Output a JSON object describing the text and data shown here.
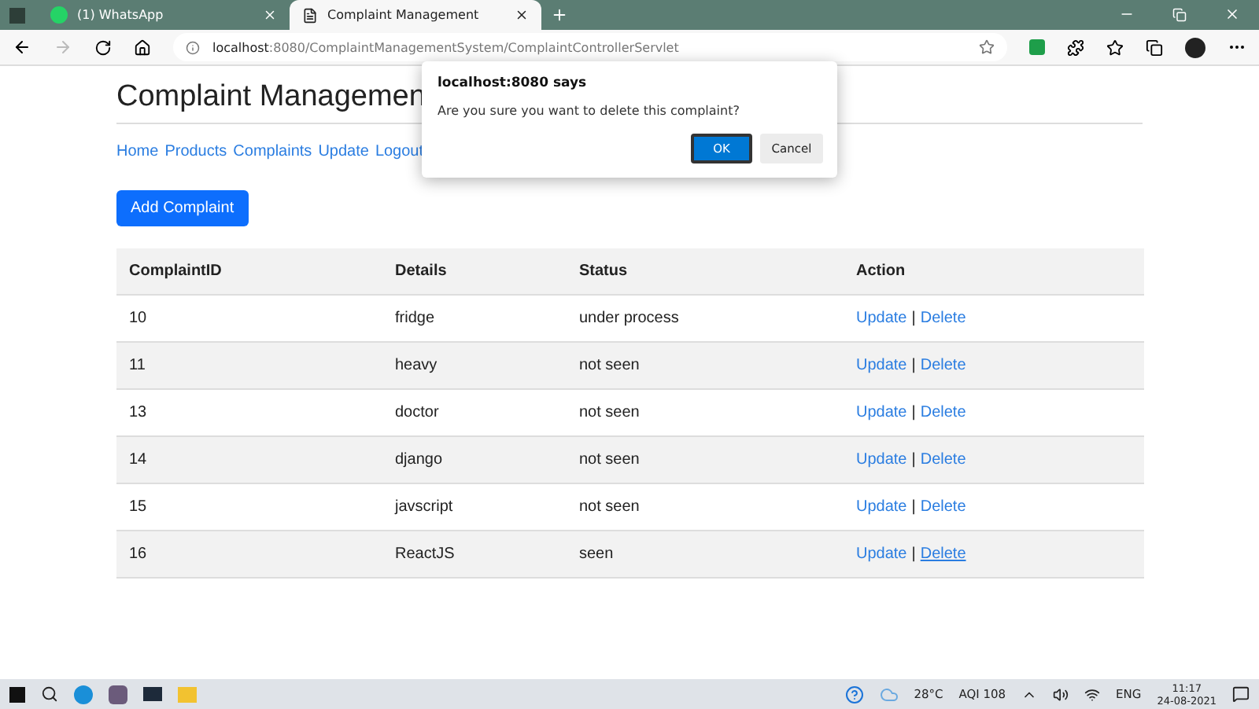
{
  "browser": {
    "tabs": [
      {
        "label": "(1) WhatsApp",
        "kind": "whatsapp",
        "selected": false
      },
      {
        "label": "Complaint Management",
        "kind": "page",
        "selected": true
      }
    ],
    "address": {
      "host": "localhost",
      "rest": ":8080/ComplaintManagementSystem/ComplaintControllerServlet"
    }
  },
  "page": {
    "title": "Complaint Managemen",
    "nav": [
      "Home",
      "Products",
      "Complaints",
      "Update",
      "Logout"
    ],
    "add_button": "Add Complaint",
    "table": {
      "columns": [
        "ComplaintID",
        "Details",
        "Status",
        "Action"
      ],
      "rows": [
        {
          "id": "10",
          "details": "fridge",
          "status": "under process",
          "update": "Update",
          "separator": "|",
          "delete": "Delete",
          "hovered": false
        },
        {
          "id": "11",
          "details": "heavy",
          "status": "not seen",
          "update": "Update",
          "separator": "|",
          "delete": "Delete",
          "hovered": false
        },
        {
          "id": "13",
          "details": "doctor",
          "status": "not seen",
          "update": "Update",
          "separator": "|",
          "delete": "Delete",
          "hovered": false
        },
        {
          "id": "14",
          "details": "django",
          "status": "not seen",
          "update": "Update",
          "separator": "|",
          "delete": "Delete",
          "hovered": false
        },
        {
          "id": "15",
          "details": "javscript",
          "status": "not seen",
          "update": "Update",
          "separator": "|",
          "delete": "Delete",
          "hovered": false
        },
        {
          "id": "16",
          "details": "ReactJS",
          "status": "seen",
          "update": "Update",
          "separator": "|",
          "delete": "Delete",
          "hovered": true
        }
      ]
    }
  },
  "dialog": {
    "title": "localhost:8080 says",
    "message": "Are you sure you want to delete this complaint?",
    "ok": "OK",
    "cancel": "Cancel"
  },
  "taskbar": {
    "temperature": "28°C",
    "aqi": "AQI 108",
    "language": "ENG",
    "time": "11:17",
    "date": "24-08-2021"
  }
}
